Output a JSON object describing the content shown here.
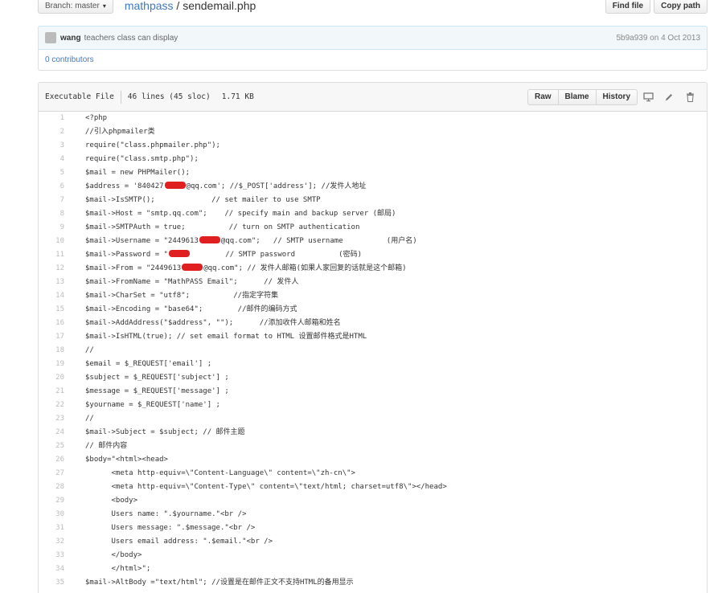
{
  "header": {
    "branch_label": "Branch: master",
    "repo": "mathpass",
    "separator": " / ",
    "file": "sendemail.php",
    "find_file": "Find file",
    "copy_path": "Copy path"
  },
  "commit": {
    "author": "wang",
    "message": "teachers class can display",
    "meta": "5b9a939 on 4 Oct 2013"
  },
  "contributors": "0 contributors",
  "file_info": {
    "type": "Executable File",
    "lines": "46 lines (45 sloc)",
    "size": "1.71 KB",
    "raw": "Raw",
    "blame": "Blame",
    "history": "History"
  },
  "icons": {
    "chevron": "chevron-down-icon",
    "desktop": "desktop-icon",
    "edit": "pencil-icon",
    "delete": "trash-icon"
  },
  "code_lines": [
    {
      "n": "1",
      "text": "<?php"
    },
    {
      "n": "2",
      "text": "//引入phpmailer类"
    },
    {
      "n": "3",
      "text": "require(\"class.phpmailer.php\");"
    },
    {
      "n": "4",
      "text": "require(\"class.smtp.php\");"
    },
    {
      "n": "5",
      "text": "$mail = new PHPMailer();"
    },
    {
      "n": "6",
      "pre": "$address = '840427",
      "post": "@qq.com'; //$_POST['address']; //发件人地址"
    },
    {
      "n": "7",
      "text": "$mail->IsSMTP();             // set mailer to use SMTP"
    },
    {
      "n": "8",
      "text": "$mail->Host = \"smtp.qq.com\";    // specify main and backup server (邮局)"
    },
    {
      "n": "9",
      "text": "$mail->SMTPAuth = true;          // turn on SMTP authentication"
    },
    {
      "n": "10",
      "pre": "$mail->Username = \"2449613",
      "post": "@qq.com\";   // SMTP username          (用户名)"
    },
    {
      "n": "11",
      "pre": "$mail->Password = \"",
      "post": "        // SMTP password          (密码)"
    },
    {
      "n": "12",
      "pre": "$mail->From = \"2449613",
      "post": "@qq.com\"; // 发件人邮箱(如果人家回复的话就是这个邮箱)"
    },
    {
      "n": "13",
      "text": "$mail->FromName = \"MathPASS Email\";      // 发件人"
    },
    {
      "n": "14",
      "text": "$mail->CharSet = \"utf8\";          //指定字符集"
    },
    {
      "n": "15",
      "text": "$mail->Encoding = \"base64\";        //邮件的编码方式"
    },
    {
      "n": "16",
      "text": "$mail->AddAddress(\"$address\", \"\");      //添加收件人邮箱和姓名"
    },
    {
      "n": "17",
      "text": "$mail->IsHTML(true); // set email format to HTML 设置邮件格式是HTML"
    },
    {
      "n": "18",
      "text": "//"
    },
    {
      "n": "19",
      "text": "$email = $_REQUEST['email'] ;"
    },
    {
      "n": "20",
      "text": "$subject = $_REQUEST['subject'] ;"
    },
    {
      "n": "21",
      "text": "$message = $_REQUEST['message'] ;"
    },
    {
      "n": "22",
      "text": "$yourname = $_REQUEST['name'] ;"
    },
    {
      "n": "23",
      "text": "//"
    },
    {
      "n": "24",
      "text": "$mail->Subject = $subject; // 邮件主题"
    },
    {
      "n": "25",
      "text": "// 邮件内容"
    },
    {
      "n": "26",
      "text": "$body=\"<html><head>"
    },
    {
      "n": "27",
      "text": "      <meta http-equiv=\\\"Content-Language\\\" content=\\\"zh-cn\\\">"
    },
    {
      "n": "28",
      "text": "      <meta http-equiv=\\\"Content-Type\\\" content=\\\"text/html; charset=utf8\\\"></head>"
    },
    {
      "n": "29",
      "text": "      <body>"
    },
    {
      "n": "30",
      "text": "      Users name: \".$yourname.\"<br />"
    },
    {
      "n": "31",
      "text": "      Users message: \".$message.\"<br />"
    },
    {
      "n": "32",
      "text": "      Users email address: \".$email.\"<br />"
    },
    {
      "n": "33",
      "text": "      </body>"
    },
    {
      "n": "34",
      "text": "      </html>\";"
    },
    {
      "n": "35",
      "text": "$mail->AltBody =\"text/html\"; //设置是在邮件正文不支持HTML的备用显示"
    }
  ]
}
